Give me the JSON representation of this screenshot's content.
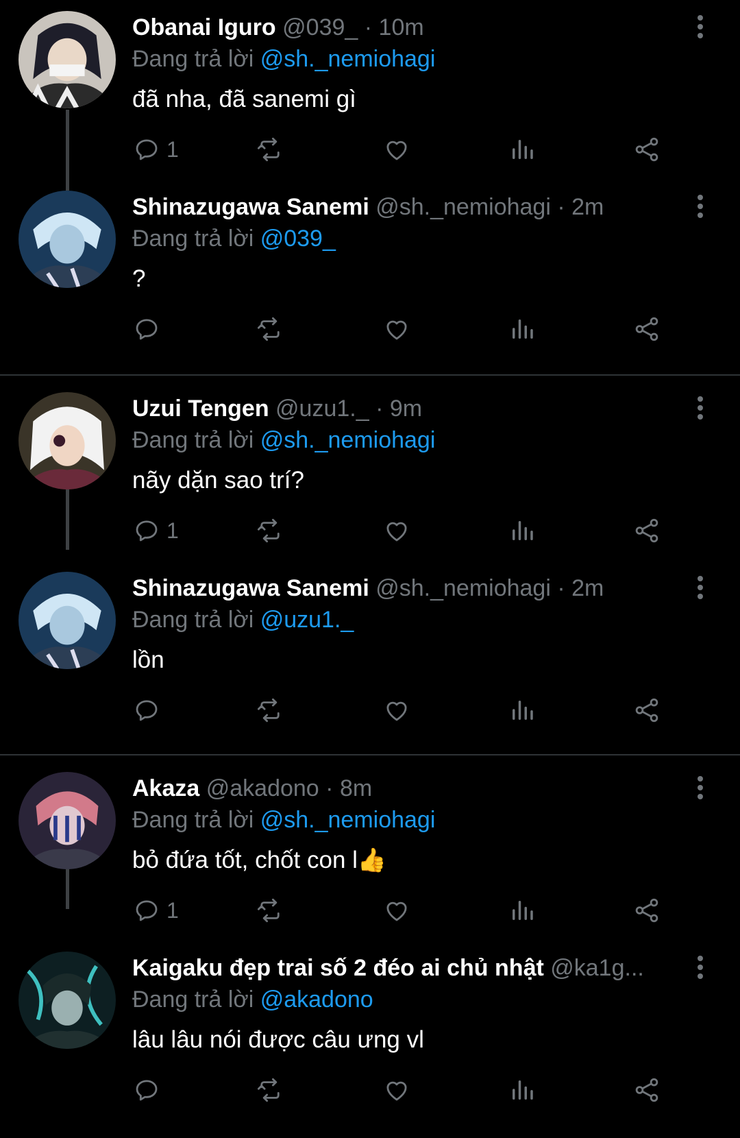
{
  "reply_prefix": "Đang trả lời",
  "tweets": [
    {
      "name": "Obanai Iguro",
      "handle": "@039_",
      "dot": "·",
      "time": "10m",
      "reply_to": "@sh._nemiohagi",
      "text": "đã nha, đã sanemi gì",
      "reply_count": "1"
    },
    {
      "name": "Shinazugawa Sanemi",
      "handle": "@sh._nemiohagi",
      "dot": "·",
      "time": "2m",
      "reply_to": "@039_",
      "text": "?",
      "reply_count": ""
    },
    {
      "name": "Uzui Tengen",
      "handle": "@uzu1._",
      "dot": "·",
      "time": "9m",
      "reply_to": "@sh._nemiohagi",
      "text": "nãy dặn sao trí?",
      "reply_count": "1"
    },
    {
      "name": "Shinazugawa Sanemi",
      "handle": "@sh._nemiohagi",
      "dot": "·",
      "time": "2m",
      "reply_to": "@uzu1._",
      "text": "lồn",
      "reply_count": ""
    },
    {
      "name": "Akaza",
      "handle": "@akadono",
      "dot": "·",
      "time": "8m",
      "reply_to": "@sh._nemiohagi",
      "text": "bỏ đứa tốt, chốt con l",
      "text_emoji": "👍",
      "reply_count": "1"
    },
    {
      "name": "Kaigaku đẹp trai số 2 đéo ai chủ nhật",
      "handle": "@ka1g...",
      "dot": "",
      "time": "",
      "reply_to": "@akadono",
      "text": "lâu lâu nói được câu ưng vl",
      "reply_count": ""
    }
  ],
  "icons": [
    "reply-icon",
    "retweet-icon",
    "like-icon",
    "views-icon",
    "share-icon",
    "more-options-icon"
  ],
  "colors": {
    "background": "#000000",
    "mention": "#1d9bf0",
    "muted": "#71767b",
    "text": "#ffffff",
    "divider": "#2f3336"
  }
}
